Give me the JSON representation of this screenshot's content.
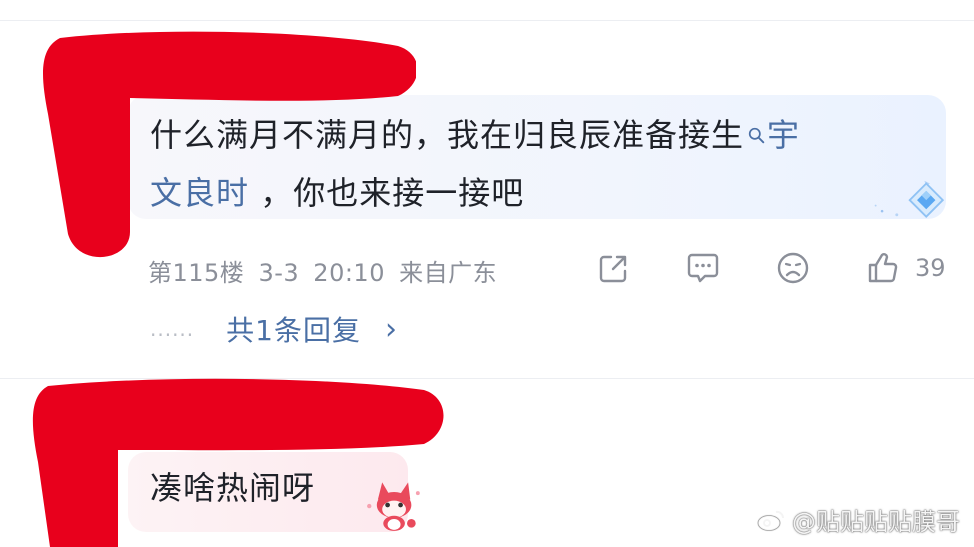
{
  "comment1": {
    "text_line1": "什么满月不满月的，我在归良辰准备接生",
    "mention_a": "宇",
    "mention_b": "文良时",
    "text_line2": " ，你也来接一接吧",
    "floor": "第115楼",
    "date": "3-3",
    "time": "20:10",
    "location": "来自广东",
    "like_count": "39",
    "replies_label": "共1条回复",
    "replies_dots": "......",
    "chevron": "›"
  },
  "comment2": {
    "text": "凑啥热闹呀"
  },
  "watermark": {
    "text": "@贴贴贴贴膜哥"
  },
  "icons": {
    "share": "share-icon",
    "comment": "comment-icon",
    "dislike": "frown-icon",
    "like": "thumbs-up-icon",
    "search": "search-icon",
    "badge": "diamond-badge-icon",
    "sticker": "fox-sticker-icon"
  },
  "colors": {
    "accent": "#4a6fa5",
    "meta_gray": "#8b8f99",
    "redaction_red": "#e8001c"
  }
}
